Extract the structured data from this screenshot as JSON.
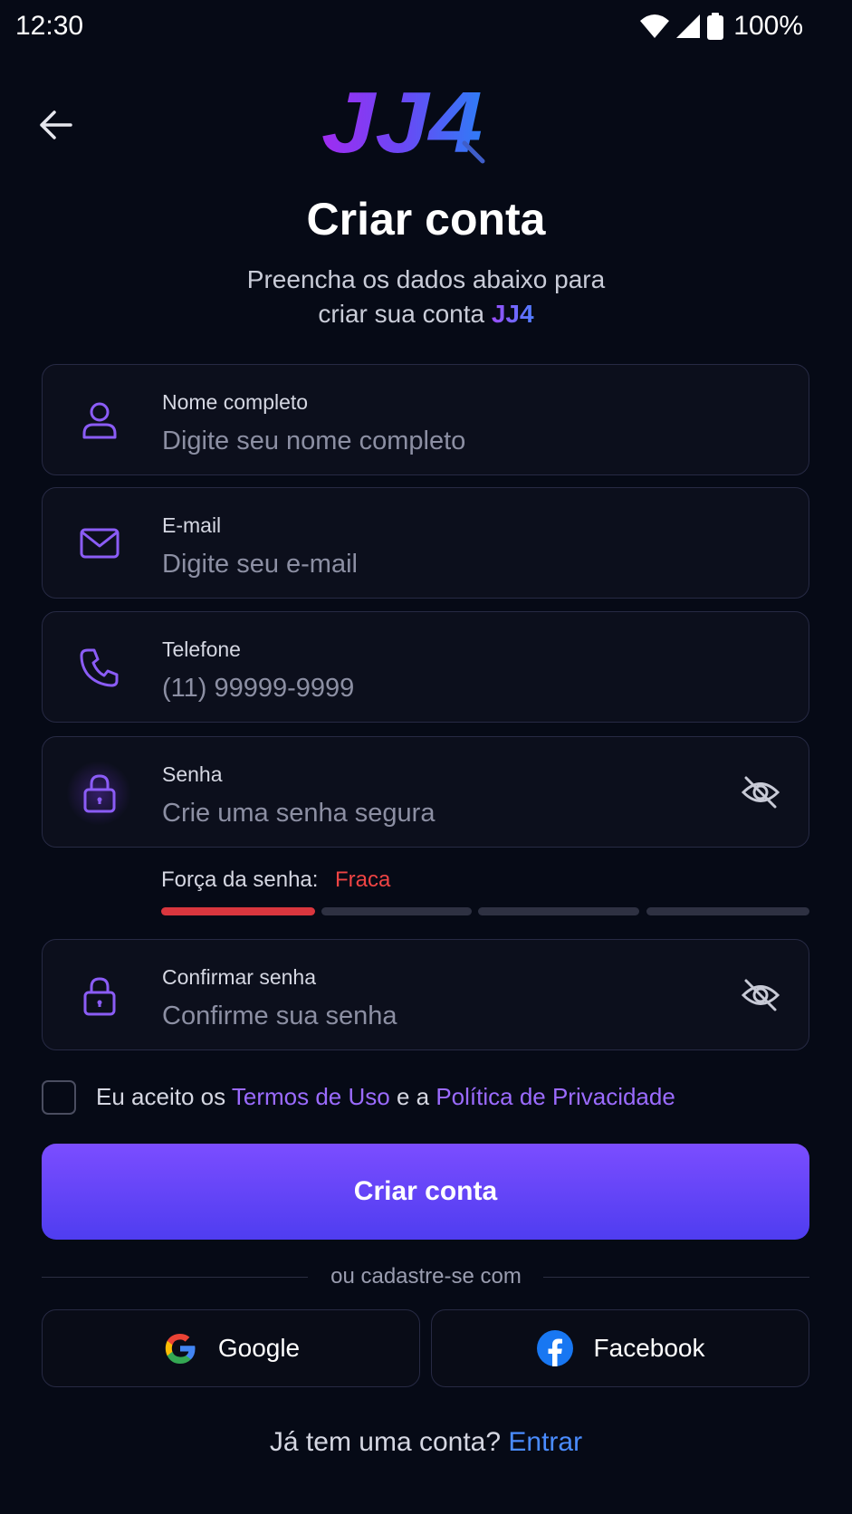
{
  "status_bar": {
    "time": "12:30",
    "battery": "100%"
  },
  "header": {
    "logo_text": "JJ4",
    "title": "Criar conta",
    "subtitle_line1": "Preencha os dados abaixo para",
    "subtitle_line2": "criar sua conta",
    "subtitle_brand": "JJ4"
  },
  "form": {
    "name": {
      "label": "Nome completo",
      "placeholder": "Digite seu nome completo"
    },
    "email": {
      "label": "E-mail",
      "placeholder": "Digite seu e-mail"
    },
    "phone": {
      "label": "Telefone",
      "placeholder": "(11) 99999-9999"
    },
    "password": {
      "label": "Senha",
      "placeholder": "Crie uma senha segura"
    },
    "password_strength": {
      "label": "Força da senha:",
      "value": "Fraca",
      "level": 1,
      "max_level": 4
    },
    "confirm_password": {
      "label": "Confirmar senha",
      "placeholder": "Confirme sua senha"
    }
  },
  "terms": {
    "prefix": "Eu aceito os",
    "terms_link": "Termos de Uso",
    "middle": "e a",
    "privacy_link": "Política de Privacidade"
  },
  "submit_label": "Criar conta",
  "divider_text": "ou cadastre-se com",
  "social": {
    "google_label": "Google",
    "facebook_label": "Facebook"
  },
  "footer": {
    "question": "Já tem uma conta?",
    "link": "Entrar"
  },
  "colors": {
    "background": "#060a16",
    "accent": "#7c3aed",
    "button_top": "#7b4dff",
    "button_bottom": "#4f3df0",
    "weak": "#d9363e",
    "link_blue": "#4a8cff"
  }
}
